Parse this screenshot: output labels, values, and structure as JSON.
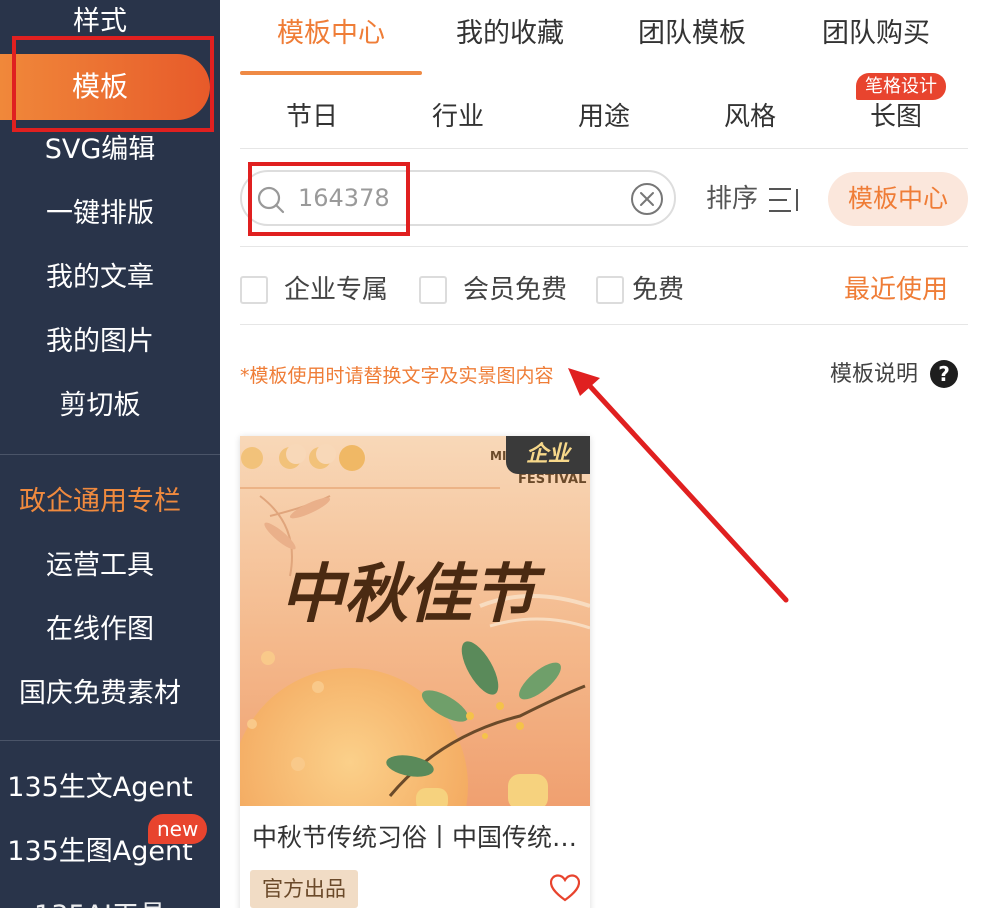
{
  "sidebar": {
    "items": [
      {
        "label": "样式"
      },
      {
        "label": "模板"
      },
      {
        "label": "SVG编辑"
      },
      {
        "label": "一键排版"
      },
      {
        "label": "我的文章"
      },
      {
        "label": "我的图片"
      },
      {
        "label": "剪切板"
      },
      {
        "label": "政企通用专栏"
      },
      {
        "label": "运营工具"
      },
      {
        "label": "在线作图"
      },
      {
        "label": "国庆免费素材"
      },
      {
        "label": "135生文Agent"
      },
      {
        "label": "135生图Agent"
      }
    ],
    "new_badge": "new",
    "accent_color": "#ef7d37",
    "bg_color": "#29344a"
  },
  "top_tabs": [
    {
      "label": "模板中心"
    },
    {
      "label": "我的收藏"
    },
    {
      "label": "团队模板"
    },
    {
      "label": "团队购买"
    }
  ],
  "categories": [
    {
      "label": "节日"
    },
    {
      "label": "行业"
    },
    {
      "label": "用途"
    },
    {
      "label": "风格"
    },
    {
      "label": "长图"
    }
  ],
  "category_badge": "笔格设计",
  "search": {
    "value": "164378",
    "sort_label": "排序",
    "center_button": "模板中心"
  },
  "filters": [
    {
      "label": "企业专属",
      "checked": false
    },
    {
      "label": "会员免费",
      "checked": false
    },
    {
      "label": "免费",
      "checked": false
    }
  ],
  "recent_link": "最近使用",
  "notice": "*模板使用时请替换文字及实景图内容",
  "help_link": "模板说明",
  "help_icon": "?",
  "card": {
    "badge": "企业",
    "title": "中秋节传统习俗丨中国传统节日",
    "tag": "官方出品",
    "artwork_title": "中秋佳节",
    "artwork_small_text_1": "MI",
    "artwork_small_text_2": "FESTIVAL"
  },
  "icons": {
    "search": "search-icon",
    "clear": "clear-icon",
    "sort": "sort-icon",
    "help": "question-icon",
    "favorite": "heart-icon"
  }
}
